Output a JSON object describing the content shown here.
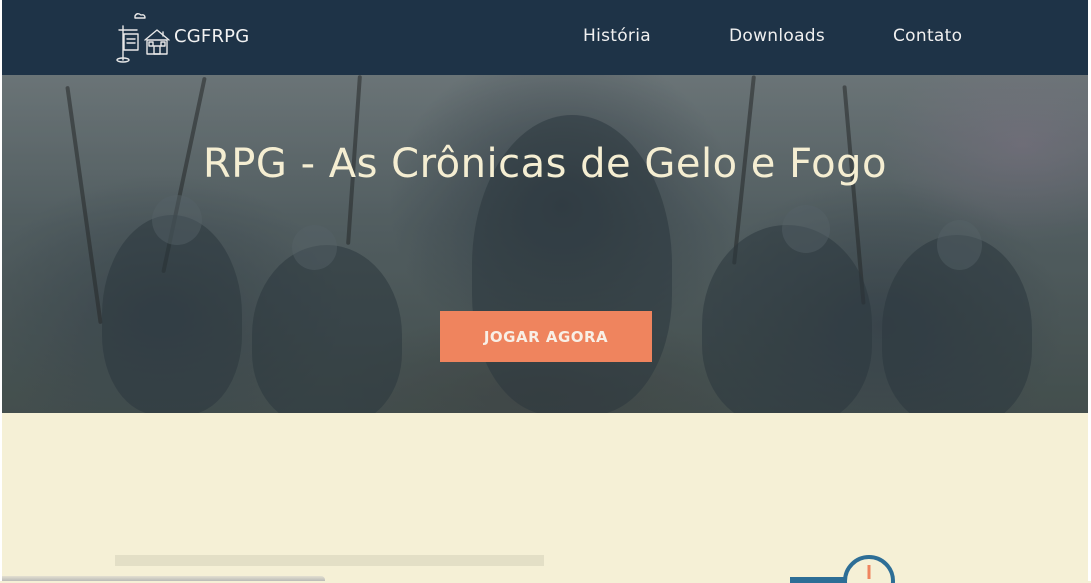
{
  "header": {
    "brand": "CGFRPG",
    "logo_icon": "sign-and-house-logo-icon",
    "nav": [
      {
        "label": "História"
      },
      {
        "label": "Downloads"
      },
      {
        "label": "Contato"
      }
    ]
  },
  "hero": {
    "title": "RPG - As Crônicas de Gelo e Fogo",
    "button_label": "JOGAR AGORA"
  },
  "colors": {
    "header_bg": "#1e3347",
    "page_bg": "#f5f0d6",
    "button_bg": "#ef845e",
    "title_text": "#f5eed2"
  },
  "icons": [
    "sign-and-house-logo-icon",
    "clock-icon"
  ]
}
